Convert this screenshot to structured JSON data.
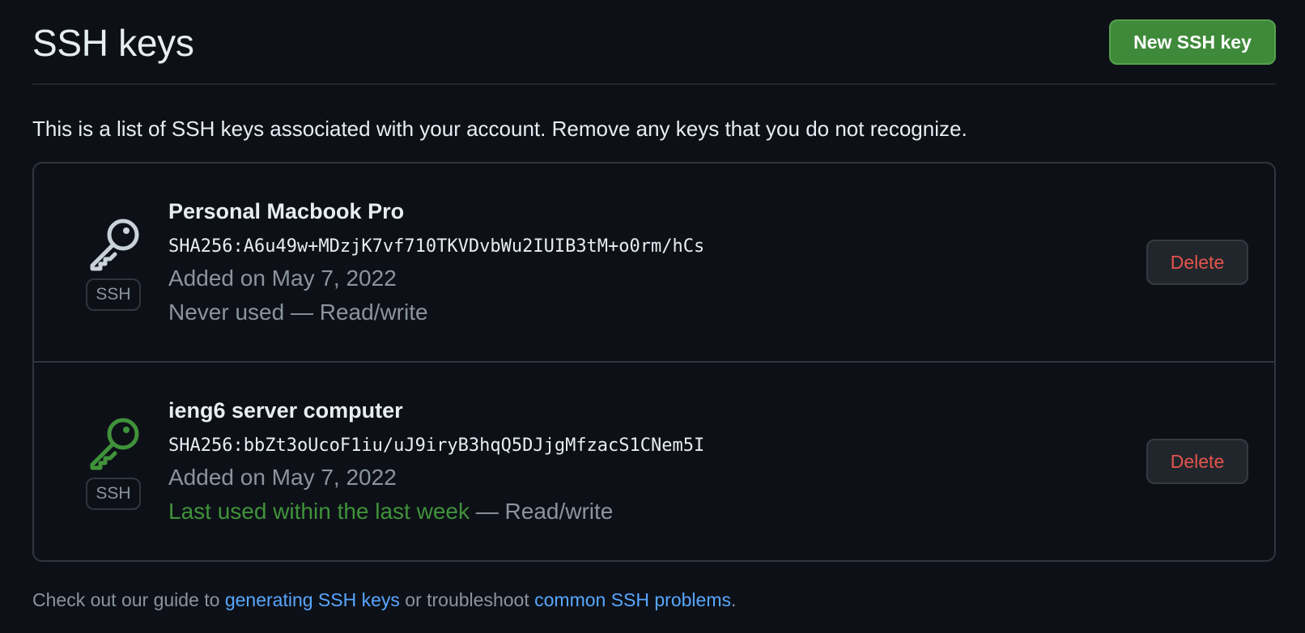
{
  "header": {
    "title": "SSH keys",
    "new_button_label": "New SSH key"
  },
  "intro_text": "This is a list of SSH keys associated with your account. Remove any keys that you do not recognize.",
  "keys": [
    {
      "name": "Personal Macbook Pro",
      "fingerprint": "SHA256:A6u49w+MDzjK7vf710TKVDvbWu2IUIB3tM+o0rm/hCs",
      "added": "Added on May 7, 2022",
      "usage_highlight": "",
      "usage_rest": "Never used — Read/write",
      "badge": "SSH",
      "icon": "key-icon",
      "icon_color": "#c9d1d9",
      "delete_label": "Delete"
    },
    {
      "name": "ieng6 server computer",
      "fingerprint": "SHA256:bbZt3oUcoF1iu/uJ9iryB3hqQ5DJjgMfzacS1CNem5I",
      "added": "Added on May 7, 2022",
      "usage_highlight": "Last used within the last week",
      "usage_rest": " — Read/write",
      "badge": "SSH",
      "icon": "key-icon",
      "icon_color": "#3fb950",
      "delete_label": "Delete"
    }
  ],
  "footer": {
    "prefix": "Check out our guide to ",
    "link1": "generating SSH keys",
    "middle": " or troubleshoot ",
    "link2": "common SSH problems",
    "suffix": "."
  },
  "colors": {
    "background": "#0d1117",
    "primary_button": "#3f8a3a",
    "danger_text": "#e5534b",
    "link": "#58a6ff",
    "recent_use": "#40923a"
  }
}
